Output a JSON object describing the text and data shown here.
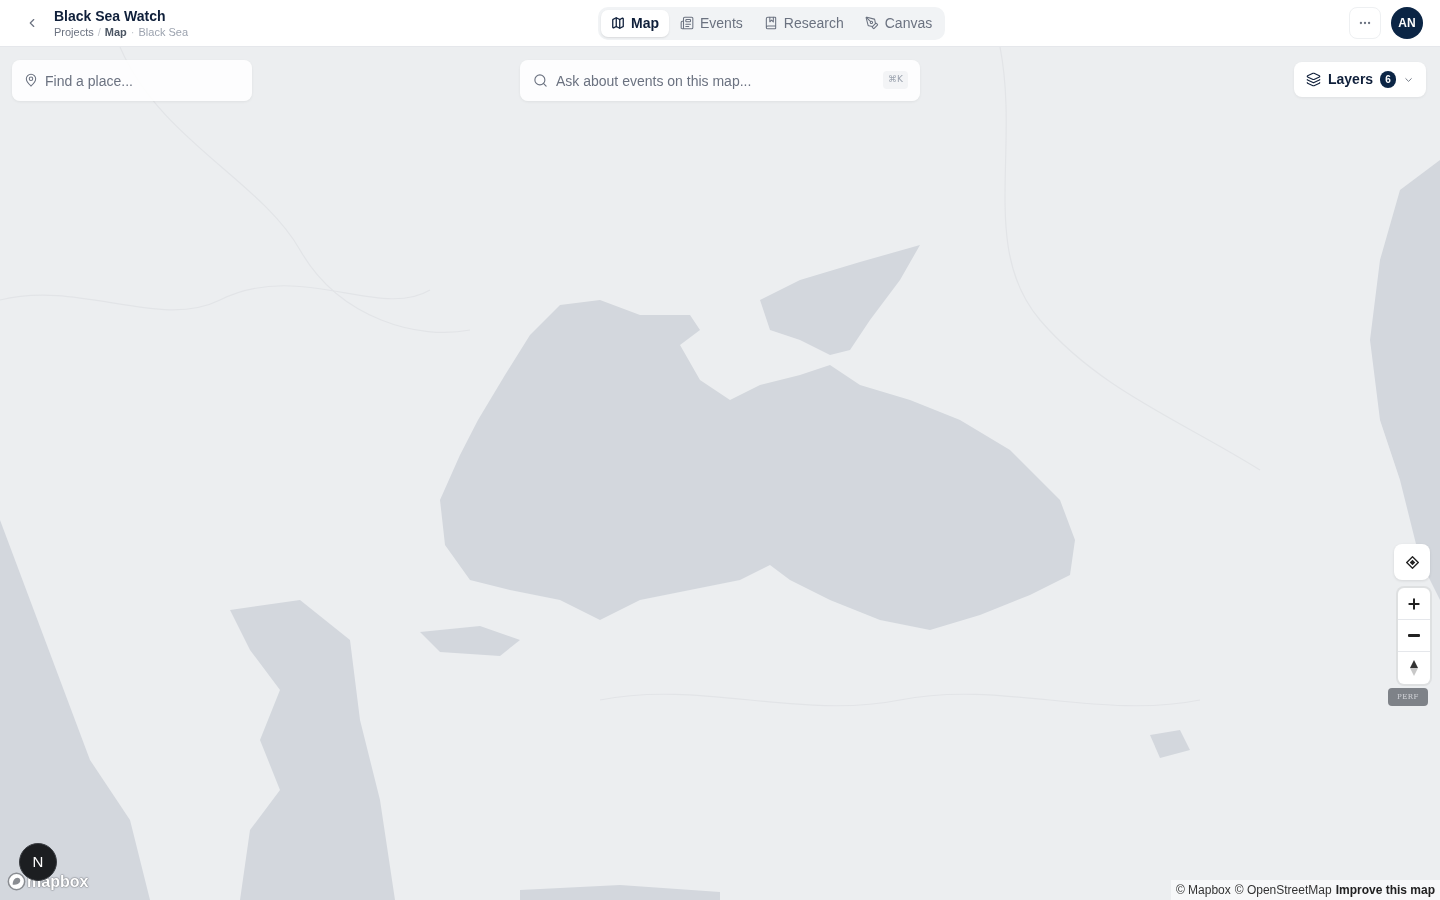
{
  "header": {
    "title": "Black Sea Watch",
    "breadcrumb": [
      {
        "label": "Projects",
        "kind": "link"
      },
      {
        "label": "/",
        "kind": "separator"
      },
      {
        "label": "Map",
        "kind": "current"
      },
      {
        "label": "·",
        "kind": "separator"
      },
      {
        "label": "Black Sea",
        "kind": "detail"
      }
    ]
  },
  "tabs": [
    {
      "label": "Map",
      "selected": true
    },
    {
      "label": "Events",
      "selected": false
    },
    {
      "label": "Research",
      "selected": false
    },
    {
      "label": "Canvas",
      "selected": false
    }
  ],
  "account": {
    "initials": "AN"
  },
  "map": {
    "place_search": {
      "placeholder": "Find a place..."
    },
    "ask": {
      "placeholder": "Ask about events on this map...",
      "shortcut": "⌘K"
    },
    "layers": {
      "label": "Layers",
      "count": "6"
    },
    "perf_badge": "PERF",
    "logo": "mapbox",
    "attribution": [
      {
        "label": "© Mapbox",
        "kind": "link"
      },
      {
        "label": "© OpenStreetMap",
        "kind": "link"
      },
      {
        "label": "Improve this map",
        "kind": "action"
      }
    ]
  },
  "dev_indicator": "N"
}
